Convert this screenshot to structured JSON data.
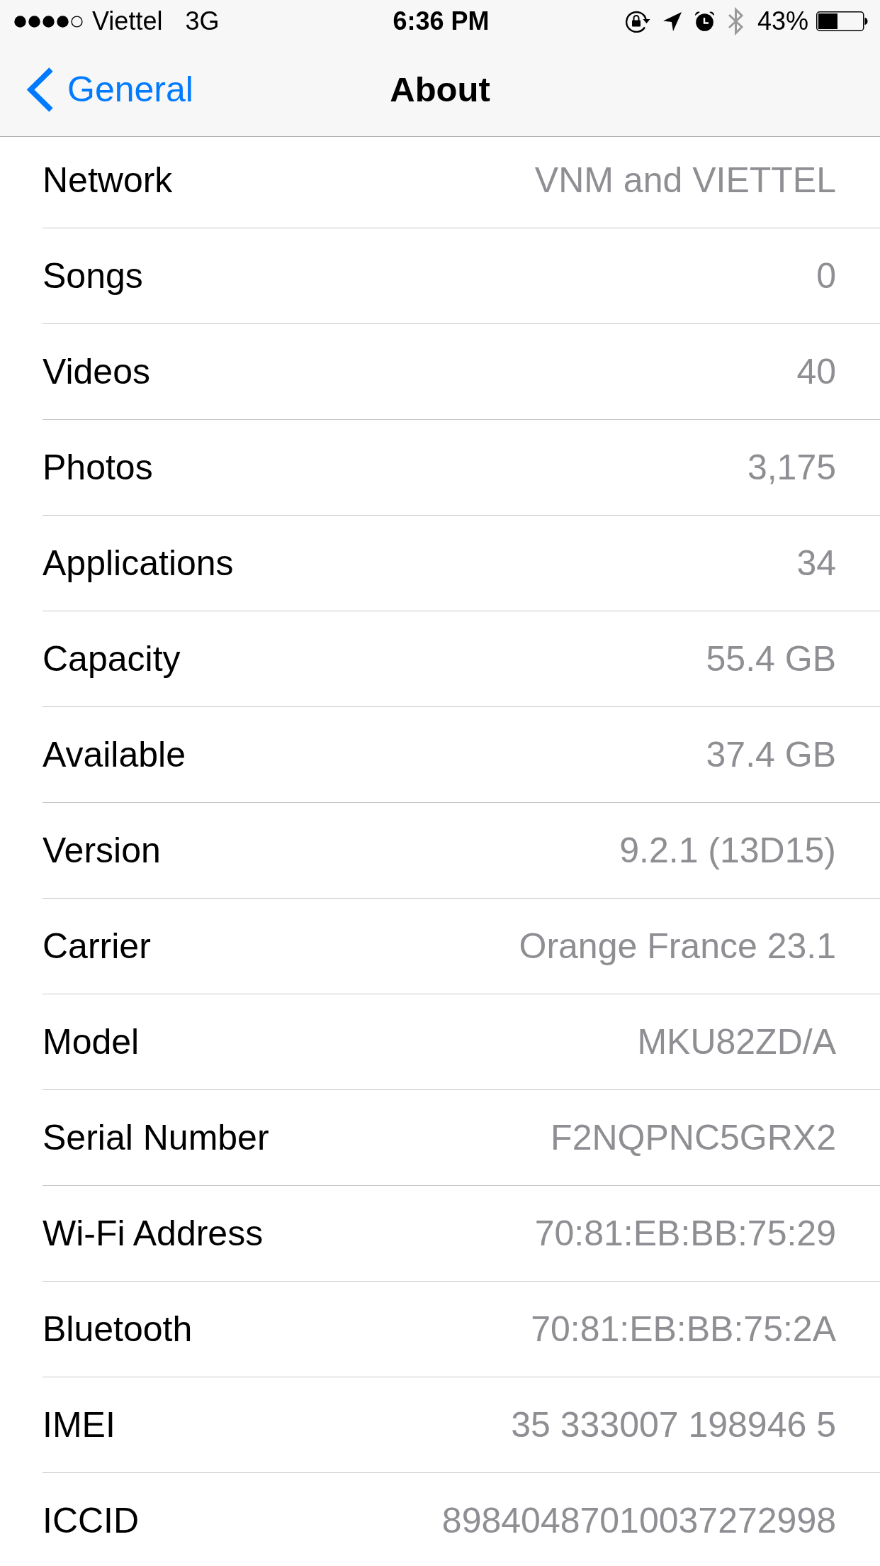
{
  "status_bar": {
    "carrier": "Viettel",
    "network_type": "3G",
    "time": "6:36 PM",
    "battery_percent": "43%"
  },
  "navigation_bar": {
    "back_button": "General",
    "title": "About"
  },
  "rows": [
    {
      "label": "Network",
      "value": "VNM and VIETTEL"
    },
    {
      "label": "Songs",
      "value": "0"
    },
    {
      "label": "Videos",
      "value": "40"
    },
    {
      "label": "Photos",
      "value": "3,175"
    },
    {
      "label": "Applications",
      "value": "34"
    },
    {
      "label": "Capacity",
      "value": "55.4 GB"
    },
    {
      "label": "Available",
      "value": "37.4 GB"
    },
    {
      "label": "Version",
      "value": "9.2.1 (13D15)"
    },
    {
      "label": "Carrier",
      "value": "Orange France 23.1"
    },
    {
      "label": "Model",
      "value": "MKU82ZD/A"
    },
    {
      "label": "Serial Number",
      "value": "F2NQPNC5GRX2"
    },
    {
      "label": "Wi-Fi Address",
      "value": "70:81:EB:BB:75:29"
    },
    {
      "label": "Bluetooth",
      "value": "70:81:EB:BB:75:2A"
    },
    {
      "label": "IMEI",
      "value": "35 333007 198946 5"
    },
    {
      "label": "ICCID",
      "value": "89840487010037272998"
    }
  ]
}
